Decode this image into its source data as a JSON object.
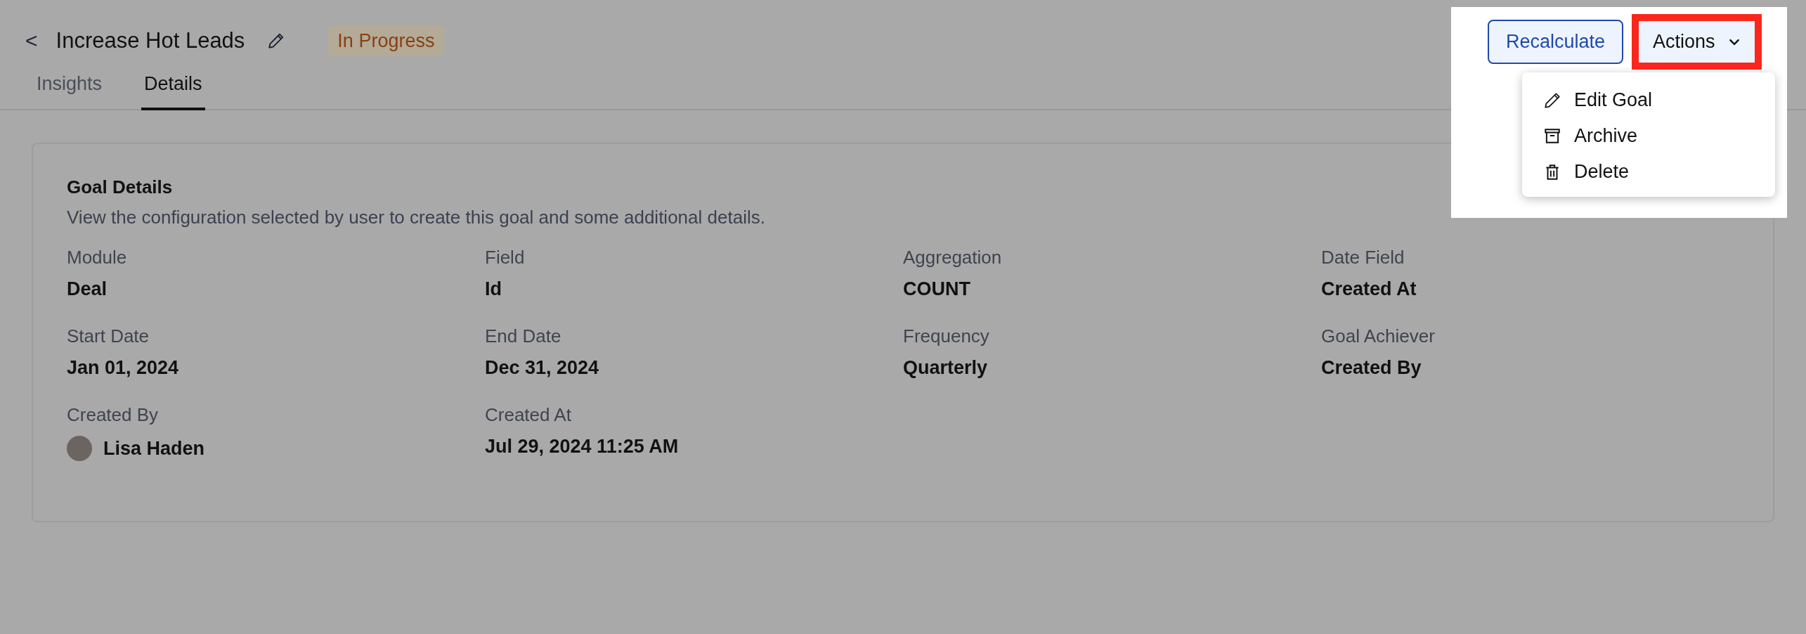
{
  "header": {
    "back": "<",
    "title": "Increase Hot Leads",
    "status": "In Progress"
  },
  "tabs": [
    {
      "label": "Insights",
      "selected": false
    },
    {
      "label": "Details",
      "selected": true
    }
  ],
  "actions": {
    "recalculate": "Recalculate",
    "actions": "Actions",
    "expanded": true,
    "menu": [
      {
        "kind": "edit",
        "label": "Edit Goal"
      },
      {
        "kind": "archive",
        "label": "Archive"
      },
      {
        "kind": "delete",
        "label": "Delete"
      }
    ]
  },
  "card": {
    "title": "Goal Details",
    "description": "View the configuration selected by user to create this goal and some additional details.",
    "fields": [
      {
        "kind": "text",
        "label": "Module",
        "value": "Deal"
      },
      {
        "kind": "text",
        "label": "Field",
        "value": "Id"
      },
      {
        "kind": "text",
        "label": "Aggregation",
        "value": "COUNT"
      },
      {
        "kind": "text",
        "label": "Date Field",
        "value": "Created At"
      },
      {
        "kind": "text",
        "label": "Start Date",
        "value": "Jan 01, 2024"
      },
      {
        "kind": "text",
        "label": "End Date",
        "value": "Dec 31, 2024"
      },
      {
        "kind": "text",
        "label": "Frequency",
        "value": "Quarterly"
      },
      {
        "kind": "text",
        "label": "Goal Achiever",
        "value": "Created By"
      },
      {
        "kind": "user",
        "label": "Created By",
        "value": "Lisa Haden"
      },
      {
        "kind": "text",
        "label": "Created At",
        "value": "Jul 29, 2024 11:25 AM"
      }
    ]
  }
}
